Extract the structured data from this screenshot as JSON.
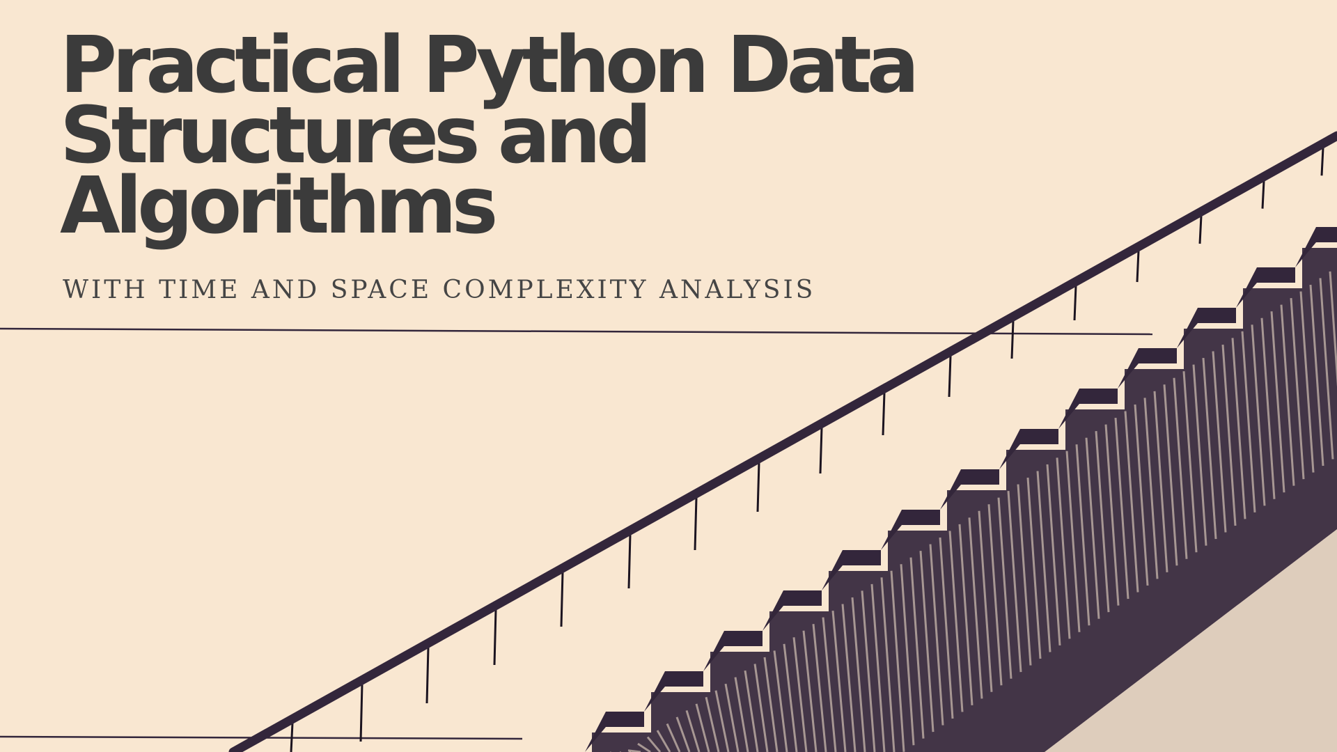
{
  "cover": {
    "title_lines": [
      "Practical Python Data",
      "Structures and",
      "Algorithms"
    ],
    "subtitle": "WITH TIME AND SPACE COMPLEXITY ANALYSIS"
  },
  "palette": {
    "background": "#f9e7d1",
    "title_color": "#3b3b3b",
    "subtitle_color": "#454545",
    "illustration_ink": "#33263b"
  },
  "illustration": {
    "subject": "staircase with handrail and balusters",
    "icon": "staircase-icon"
  }
}
